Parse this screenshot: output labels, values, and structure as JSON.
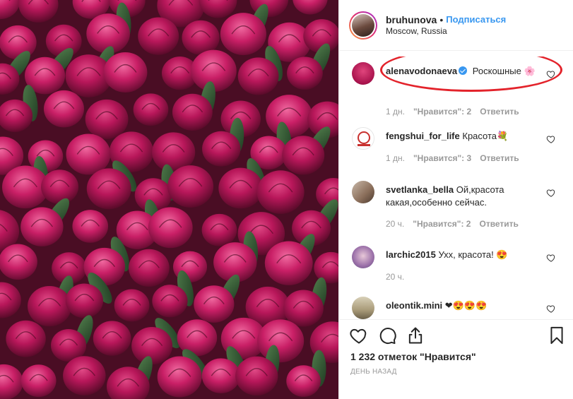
{
  "header": {
    "username": "bruhunova",
    "separator": "•",
    "follow_label": "Подписаться",
    "location": "Moscow, Russia"
  },
  "comments": [
    {
      "user": "alenavodonaeva",
      "verified": true,
      "text": "Роскошные 🌸",
      "age": "1 дн.",
      "likes": "\"Нравится\": 2",
      "reply": "Ответить"
    },
    {
      "user": "fengshui_for_life",
      "verified": false,
      "text": "Красота💐",
      "age": "1 дн.",
      "likes": "\"Нравится\": 3",
      "reply": "Ответить"
    },
    {
      "user": "svetlanka_bella",
      "verified": false,
      "text": "Ой,красота какая,особенно сейчас.",
      "age": "20 ч.",
      "likes": "\"Нравится\": 2",
      "reply": "Ответить"
    },
    {
      "user": "larchic2015",
      "verified": false,
      "text": "Ухх, красота! 😍",
      "age": "20 ч.",
      "likes": "",
      "reply": ""
    },
    {
      "user": "oleontik.mini",
      "verified": false,
      "text": "❤😍😍😍",
      "age": "",
      "likes": "",
      "reply": ""
    }
  ],
  "actions": {
    "icons": [
      "heart-icon",
      "comment-icon",
      "share-icon",
      "bookmark-icon"
    ],
    "likes_count": "1 232 отметок \"Нравится\"",
    "posted": "ДЕНЬ НАЗАД"
  },
  "colors": {
    "accent": "#3897f0",
    "highlight": "#e3232b",
    "muted": "#999999"
  }
}
